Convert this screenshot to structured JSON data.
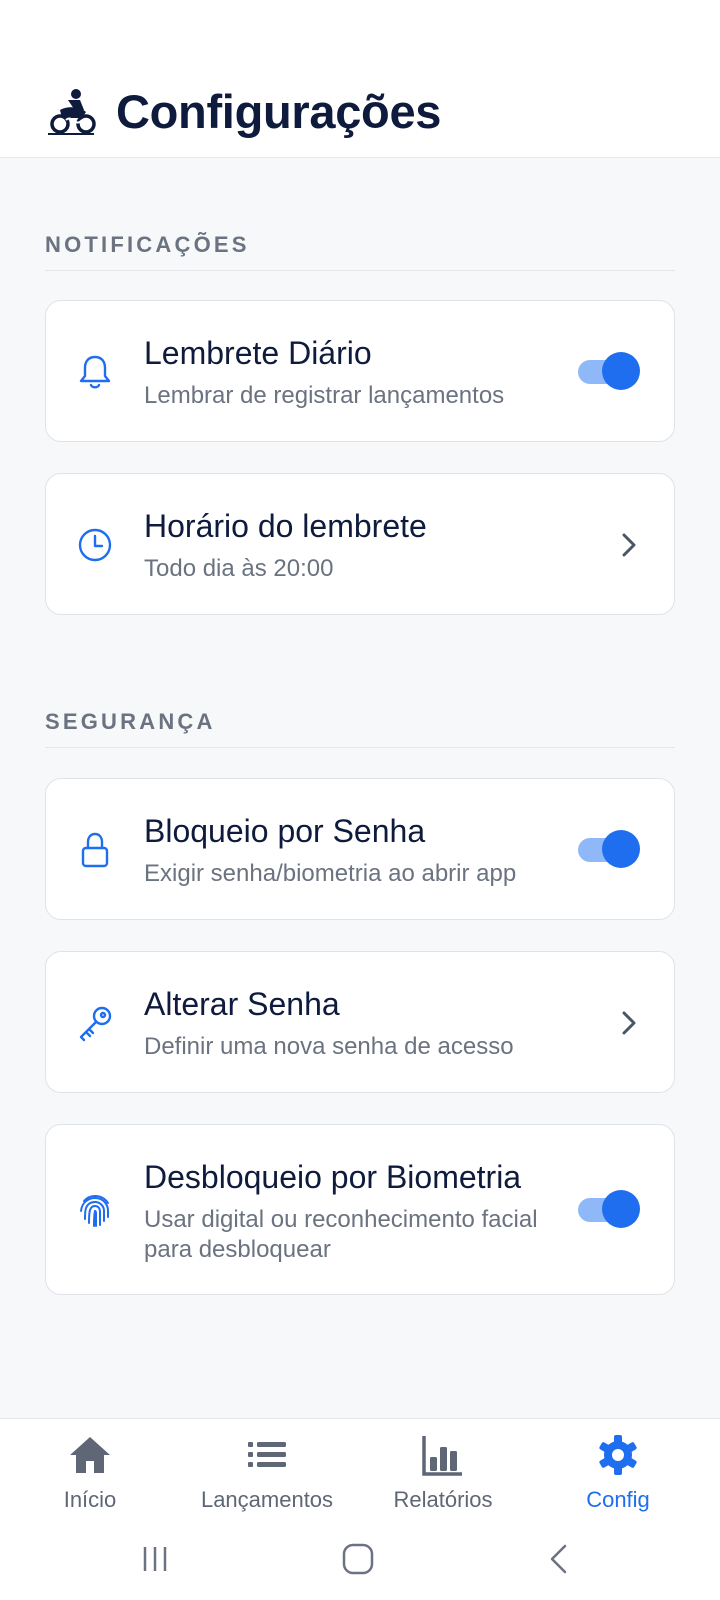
{
  "header": {
    "title": "Configurações",
    "logo_icon": "motorcycle-rider-icon"
  },
  "sections": [
    {
      "title": "NOTIFICAÇÕES",
      "items": [
        {
          "title": "Lembrete Diário",
          "subtitle": "Lembrar de registrar lançamentos",
          "icon": "bell-icon",
          "control": "toggle",
          "enabled": true
        },
        {
          "title": "Horário do lembrete",
          "subtitle": "Todo dia às 20:00",
          "icon": "clock-icon",
          "control": "chevron"
        }
      ]
    },
    {
      "title": "SEGURANÇA",
      "items": [
        {
          "title": "Bloqueio por Senha",
          "subtitle": "Exigir senha/biometria ao abrir app",
          "icon": "lock-icon",
          "control": "toggle",
          "enabled": true
        },
        {
          "title": "Alterar Senha",
          "subtitle": "Definir uma nova senha de acesso",
          "icon": "key-icon",
          "control": "chevron"
        },
        {
          "title": "Desbloqueio por Biometria",
          "subtitle": "Usar digital ou reconhecimento facial para desbloquear",
          "icon": "fingerprint-icon",
          "control": "toggle",
          "enabled": true
        }
      ]
    }
  ],
  "bottom_nav": {
    "items": [
      {
        "label": "Início",
        "icon": "home-icon",
        "active": false
      },
      {
        "label": "Lançamentos",
        "icon": "list-icon",
        "active": false
      },
      {
        "label": "Relatórios",
        "icon": "bar-chart-icon",
        "active": false
      },
      {
        "label": "Config",
        "icon": "gear-icon",
        "active": true
      }
    ]
  },
  "colors": {
    "accent": "#1f6ef0",
    "toggle_track": "#8fb8f8",
    "title": "#0f1b3d",
    "muted": "#6b7280",
    "background": "#f7f8fa"
  }
}
